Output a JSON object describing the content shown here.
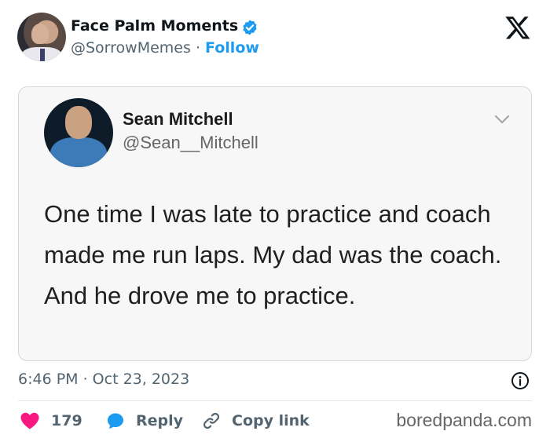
{
  "tweet": {
    "author_name": "Face Palm Moments",
    "handle": "@SorrowMemes",
    "separator": " · ",
    "follow_label": "Follow",
    "timestamp": "6:46 PM · Oct 23, 2023"
  },
  "quoted": {
    "name": "Sean Mitchell",
    "handle": "@Sean__Mitchell",
    "text": "One time I was late to practice and coach made me run laps. My dad was the coach. And he drove me to practice."
  },
  "actions": {
    "like_count": "179",
    "reply_label": "Reply",
    "copy_label": "Copy link"
  },
  "watermark": "boredpanda.com",
  "colors": {
    "accent": "#1d9bf0",
    "like": "#f91880",
    "text": "#0f1419",
    "muted": "#536471"
  },
  "icons": [
    "verified-badge-icon",
    "x-logo-icon",
    "chevron-down-icon",
    "info-icon",
    "heart-icon",
    "reply-bubble-icon",
    "link-icon"
  ]
}
